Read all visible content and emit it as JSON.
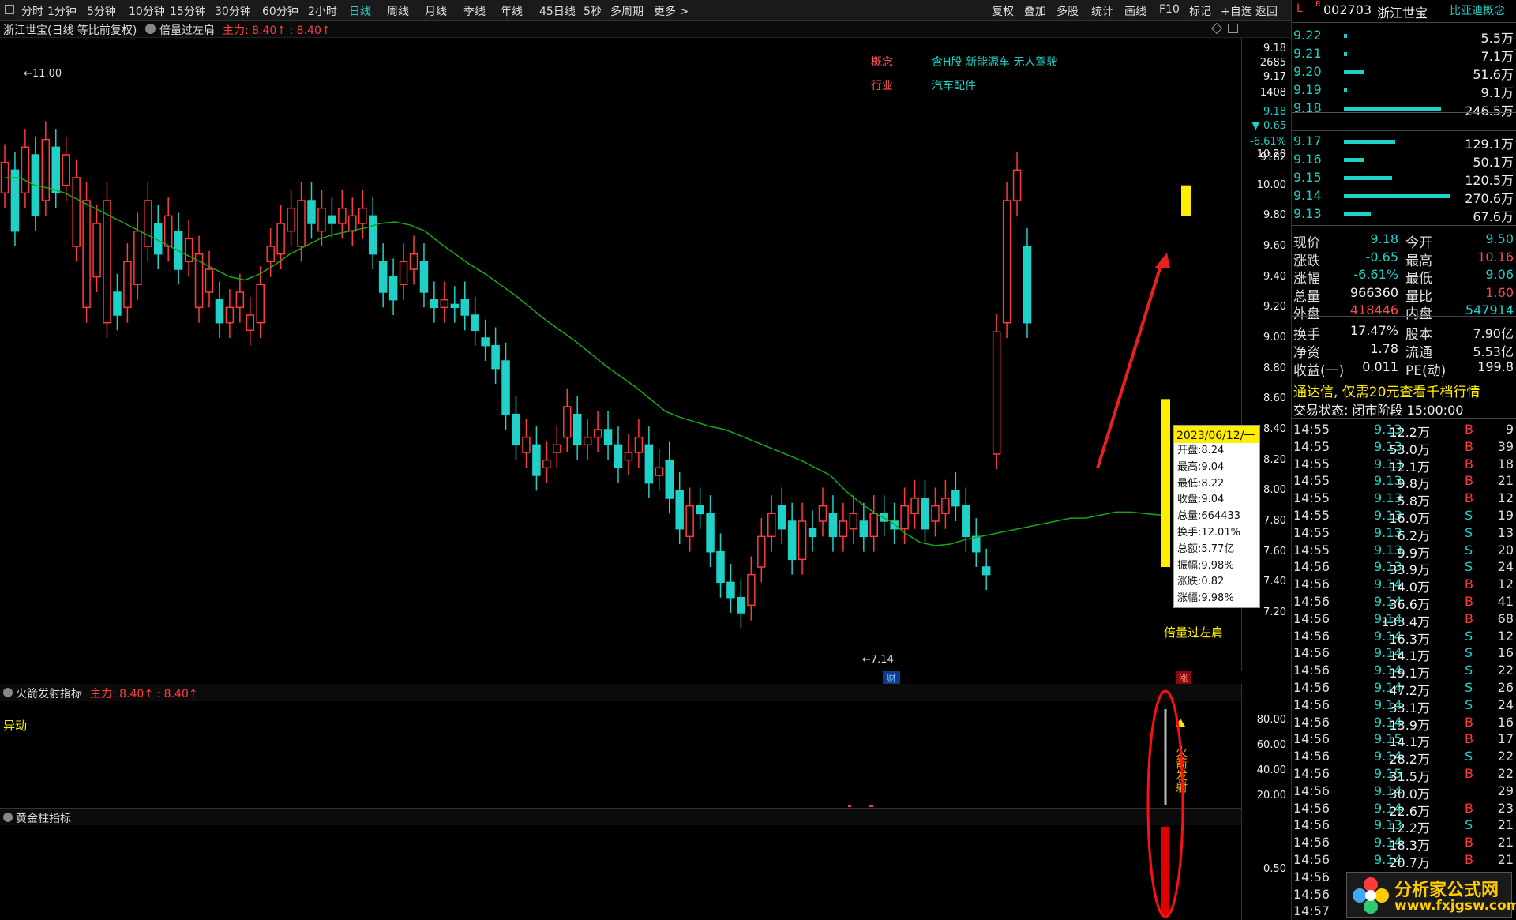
{
  "toolbar": {
    "left_items": [
      "分时",
      "1分钟",
      "5分钟",
      "10分钟",
      "15分钟",
      "30分钟",
      "60分钟",
      "2小时",
      "日线",
      "周线",
      "月线",
      "季线",
      "年线",
      "45日线",
      "5秒",
      "多周期",
      "更多 >"
    ],
    "active": "日线",
    "right_items": [
      "复权",
      "叠加",
      "多股",
      "统计",
      "画线",
      "F10",
      "标记",
      "+自选",
      "返回"
    ]
  },
  "title_bar": {
    "stock": "浙江世宝(日线 等比前复权)",
    "indicator": "倍量过左肩",
    "main_label": "主力: 8.40↑ : 8.40↑"
  },
  "chart_info": {
    "concept_label": "概念",
    "concept_value": "含H股 新能源车 无人驾驶",
    "industry_label": "行业",
    "industry_value": "汽车配件",
    "high_marker": "11.00",
    "low_marker": "7.14",
    "signal_label": "倍量过左肩",
    "finance_tag": "财",
    "rise_tag": "涨"
  },
  "y_axis_main": {
    "top_labels": [
      "9.18",
      "2685",
      "9.17",
      "1408",
      "9.18",
      "▼-0.65",
      "-6.61%",
      "9182"
    ],
    "ticks": [
      "10.20",
      "10.00",
      "9.80",
      "9.60",
      "9.40",
      "9.20",
      "9.00",
      "8.80",
      "8.60",
      "8.40",
      "8.20",
      "8.00",
      "7.80",
      "7.60",
      "7.40",
      "7.20"
    ]
  },
  "tooltip": {
    "date": "2023/06/12/一",
    "rows": [
      "开盘:8.24",
      "最高:9.04",
      "最低:8.22",
      "收盘:9.04",
      "总量:664433",
      "换手:12.01%",
      "总额:5.77亿",
      "振幅:9.98%",
      "涨跌:0.82",
      "涨幅:9.98%"
    ]
  },
  "indicator1": {
    "name": "火箭发射指标",
    "main_label": "主力: 8.40↑ : 8.40↑",
    "signal_text": "异动",
    "rocket_text": "火箭发射",
    "y_ticks": [
      "80.00",
      "60.00",
      "40.00",
      "20.00"
    ]
  },
  "indicator2": {
    "name": "黄金柱指标",
    "y_ticks": [
      "0.50"
    ]
  },
  "quote_panel": {
    "header_L": "L",
    "header_R": "R",
    "code": "002703",
    "name": "浙江世宝",
    "concept": "比亚迪概念",
    "ask_levels": [
      {
        "price": "9.22",
        "vol": "5.5万",
        "bar": 0.02
      },
      {
        "price": "9.21",
        "vol": "7.1万",
        "bar": 0.02
      },
      {
        "price": "9.20",
        "vol": "51.6万",
        "bar": 0.19
      },
      {
        "price": "9.19",
        "vol": "9.1万",
        "bar": 0.03
      },
      {
        "price": "9.18",
        "vol": "246.5万",
        "bar": 0.91
      }
    ],
    "bid_levels": [
      {
        "price": "9.17",
        "vol": "129.1万",
        "bar": 0.48
      },
      {
        "price": "9.16",
        "vol": "50.1万",
        "bar": 0.19
      },
      {
        "price": "9.15",
        "vol": "120.5万",
        "bar": 0.45
      },
      {
        "price": "9.14",
        "vol": "270.6万",
        "bar": 1.0
      },
      {
        "price": "9.13",
        "vol": "67.6万",
        "bar": 0.25
      }
    ],
    "stats": [
      {
        "l1": "现价",
        "v1": "9.18",
        "c1": "#1fd1c6",
        "l2": "今开",
        "v2": "9.50",
        "c2": "#1fd1c6"
      },
      {
        "l1": "涨跌",
        "v1": "-0.65",
        "c1": "#1fd1c6",
        "l2": "最高",
        "v2": "10.16",
        "c2": "#ff4a4a"
      },
      {
        "l1": "涨幅",
        "v1": "-6.61%",
        "c1": "#1fd1c6",
        "l2": "最低",
        "v2": "9.06",
        "c2": "#1fd1c6"
      },
      {
        "l1": "总量",
        "v1": "966360",
        "c1": "#eeeeee",
        "l2": "量比",
        "v2": "1.60",
        "c2": "#ff4a4a"
      },
      {
        "l1": "外盘",
        "v1": "418446",
        "c1": "#ff4a4a",
        "l2": "内盘",
        "v2": "547914",
        "c2": "#1fd1c6"
      }
    ],
    "stats2": [
      {
        "l1": "换手",
        "v1": "17.47%",
        "l2": "股本",
        "v2": "7.90亿"
      },
      {
        "l1": "净资",
        "v1": "1.78",
        "l2": "流通",
        "v2": "5.53亿"
      },
      {
        "l1": "收益(一)",
        "v1": "0.011",
        "l2": "PE(动)",
        "v2": "199.8"
      }
    ],
    "promo": "通达信, 仅需20元查看千档行情",
    "trade_status": "交易状态: 闭市阶段 15:00:00",
    "trades": [
      {
        "t": "14:55",
        "p": "9.13",
        "v": "12.2万",
        "d": "B",
        "n": "9"
      },
      {
        "t": "14:55",
        "p": "9.13",
        "v": "53.0万",
        "d": "B",
        "n": "39"
      },
      {
        "t": "14:55",
        "p": "9.13",
        "v": "12.1万",
        "d": "B",
        "n": "18"
      },
      {
        "t": "14:55",
        "p": "9.13",
        "v": "9.8万",
        "d": "B",
        "n": "21"
      },
      {
        "t": "14:55",
        "p": "9.13",
        "v": "5.8万",
        "d": "B",
        "n": "12"
      },
      {
        "t": "14:55",
        "p": "9.13",
        "v": "16.0万",
        "d": "S",
        "n": "19"
      },
      {
        "t": "14:55",
        "p": "9.13",
        "v": "6.2万",
        "d": "S",
        "n": "13"
      },
      {
        "t": "14:55",
        "p": "9.13",
        "v": "9.9万",
        "d": "S",
        "n": "20"
      },
      {
        "t": "14:56",
        "p": "9.13",
        "v": "33.9万",
        "d": "S",
        "n": "24"
      },
      {
        "t": "14:56",
        "p": "9.14",
        "v": "14.0万",
        "d": "B",
        "n": "12"
      },
      {
        "t": "14:56",
        "p": "9.14",
        "v": "36.6万",
        "d": "B",
        "n": "41"
      },
      {
        "t": "14:56",
        "p": "9.14",
        "v": "133.4万",
        "d": "B",
        "n": "68"
      },
      {
        "t": "14:56",
        "p": "9.14",
        "v": "16.3万",
        "d": "S",
        "n": "12"
      },
      {
        "t": "14:56",
        "p": "9.14",
        "v": "14.1万",
        "d": "S",
        "n": "16"
      },
      {
        "t": "14:56",
        "p": "9.14",
        "v": "19.1万",
        "d": "S",
        "n": "22"
      },
      {
        "t": "14:56",
        "p": "9.14",
        "v": "47.2万",
        "d": "S",
        "n": "26"
      },
      {
        "t": "14:56",
        "p": "9.14",
        "v": "33.1万",
        "d": "S",
        "n": "24"
      },
      {
        "t": "14:56",
        "p": "9.14",
        "v": "13.9万",
        "d": "B",
        "n": "16"
      },
      {
        "t": "14:56",
        "p": "9.15",
        "v": "14.1万",
        "d": "B",
        "n": "17"
      },
      {
        "t": "14:56",
        "p": "9.14",
        "v": "28.2万",
        "d": "S",
        "n": "22"
      },
      {
        "t": "14:56",
        "p": "9.15",
        "v": "31.5万",
        "d": "B",
        "n": "22"
      },
      {
        "t": "14:56",
        "p": "9.14",
        "v": "30.0万",
        "d": "",
        "n": "29"
      },
      {
        "t": "14:56",
        "p": "9.14",
        "v": "22.6万",
        "d": "B",
        "n": "23"
      },
      {
        "t": "14:56",
        "p": "9.13",
        "v": "12.2万",
        "d": "S",
        "n": "21"
      },
      {
        "t": "14:56",
        "p": "9.14",
        "v": "18.3万",
        "d": "B",
        "n": "21"
      },
      {
        "t": "14:56",
        "p": "9.14",
        "v": "20.7万",
        "d": "B",
        "n": "21"
      },
      {
        "t": "14:56",
        "p": "",
        "v": "",
        "d": "",
        "n": ""
      },
      {
        "t": "14:56",
        "p": "",
        "v": "",
        "d": "",
        "n": ""
      },
      {
        "t": "14:57",
        "p": "",
        "v": "",
        "d": "",
        "n": ""
      }
    ]
  },
  "watermark": {
    "title": "分析家公式网",
    "url": "www.fxjgsw.com"
  },
  "colors": {
    "up": "#ff3b3b",
    "down": "#1fd1c6",
    "ma_down": "#1aa61a",
    "ma_up": "#d22020",
    "signal": "#ffee00"
  }
}
